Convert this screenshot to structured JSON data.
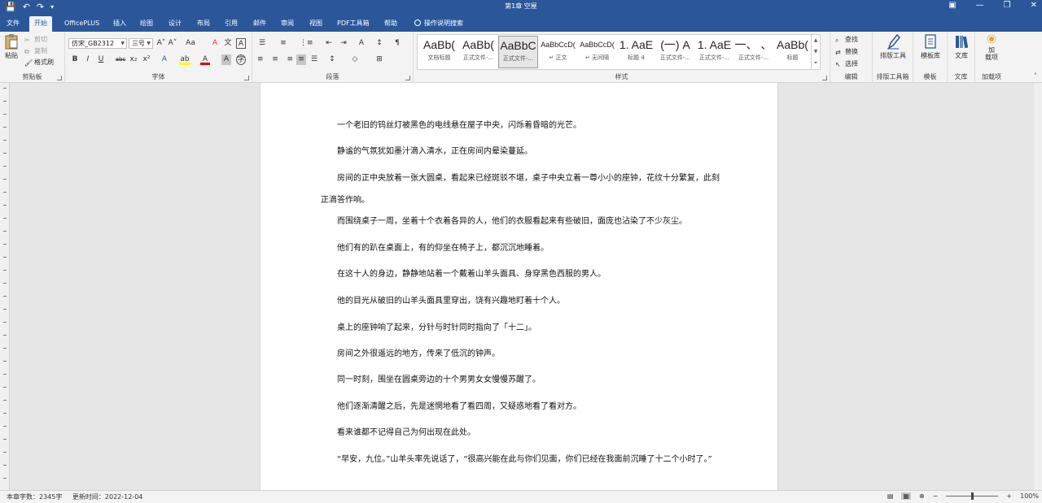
{
  "titlebar": {
    "title": "第1章 空屋",
    "quick_access": {
      "save": "💾",
      "undo": "↶",
      "redo": "↷",
      "customize": "▾"
    },
    "window_controls": {
      "ribbon_options": "▣",
      "minimize": "—",
      "restore": "❐",
      "close": "✕"
    }
  },
  "tabs": [
    "文件",
    "开始",
    "OfficePLUS",
    "插入",
    "绘图",
    "设计",
    "布局",
    "引用",
    "邮件",
    "审阅",
    "视图",
    "PDF工具箱",
    "帮助"
  ],
  "tell_me": "操作说明搜索",
  "clipboard": {
    "label": "剪贴板",
    "paste": "粘贴",
    "cut": "剪切",
    "copy": "复制",
    "format_painter": "格式刷"
  },
  "font": {
    "label": "字体",
    "name": "仿宋_GB2312",
    "size": "三号",
    "grow": "A˄",
    "shrink": "A˅",
    "case": "Aa",
    "clear": "A",
    "phonetic": "文",
    "border": "A",
    "bold": "B",
    "italic": "I",
    "underline": "U",
    "strike": "abc",
    "sub": "x₂",
    "sup": "x²",
    "effects": "A",
    "highlight": "ab",
    "color": "A",
    "shade": "A",
    "enclose": "字"
  },
  "paragraph": {
    "label": "段落",
    "bullets": "☰",
    "numbering": "≡",
    "multilevel": "⋮≡",
    "decrease_indent": "⇤",
    "increase_indent": "⇥",
    "chinese_layout": "A",
    "sort": "↕",
    "show_marks": "¶",
    "align_left": "≡",
    "align_center": "≡",
    "align_right": "≡",
    "justify": "≡",
    "distributed": "☰",
    "line_spacing": "↕",
    "shading": "◇",
    "borders": "⊞"
  },
  "styles": {
    "label": "样式",
    "items": [
      {
        "preview": "AaBb(",
        "name": "文档标题"
      },
      {
        "preview": "AaBb(",
        "name": "正式文件-..."
      },
      {
        "preview": "AaBbC",
        "name": "正式文件-..."
      },
      {
        "preview": "AaBbCcD(",
        "name": "↵ 正文"
      },
      {
        "preview": "AaBbCcD(",
        "name": "↵ 无间隔"
      },
      {
        "preview": "1. AaE",
        "name": "标题 4"
      },
      {
        "preview": "(一) A",
        "name": "正式文件-..."
      },
      {
        "preview": "1. AaE",
        "name": "正式文件-..."
      },
      {
        "preview": "一、 、",
        "name": "正式文件-..."
      },
      {
        "preview": "AaBb(",
        "name": "标题"
      }
    ],
    "scroll": {
      "up": "▲",
      "down": "▼",
      "more": "⏷"
    }
  },
  "editing": {
    "label": "编辑",
    "find": "查找",
    "replace": "替换",
    "select": "选择"
  },
  "layout_tools": {
    "label": "排版工具箱",
    "button": "排版工具"
  },
  "template": {
    "label": "模板",
    "button": "模板库"
  },
  "library": {
    "label": "文库",
    "button": "文库"
  },
  "addins": {
    "label": "加载项",
    "button": "加\n载项"
  },
  "document": {
    "paragraphs": [
      "一个老旧的钨丝灯被黑色的电线悬在屋子中央，闪烁着昏暗的光芒。",
      "静谧的气氛犹如墨汁滴入清水，正在房间内晕染蔓延。",
      "房间的正中央放着一张大圆桌，看起来已经斑驳不堪，桌子中央立着一尊小小的座钟，花纹十分繁复，此刻正滴答作响。",
      "而围绕桌子一周，坐着十个衣着各异的人，他们的衣服看起来有些破旧，面庞也沾染了不少灰尘。",
      "他们有的趴在桌面上，有的仰坐在椅子上，都沉沉地睡着。",
      "在这十人的身边，静静地站着一个戴着山羊头面具、身穿黑色西服的男人。",
      "他的目光从破旧的山羊头面具里穿出，饶有兴趣地盯着十个人。",
      "桌上的座钟响了起来，分针与时针同时指向了「十二」。",
      "房间之外很遥远的地方，传来了低沉的钟声。",
      "同一时刻，围坐在圆桌旁边的十个男男女女慢慢苏醒了。",
      "他们逐渐清醒之后，先是迷惘地看了看四周，又疑惑地看了看对方。",
      "看来谁都不记得自己为何出现在此处。",
      "“早安，九位。”山羊头率先说话了，“很高兴能在此与你们见面，你们已经在我面前沉睡了十二个小时了。”"
    ]
  },
  "statusbar": {
    "word_count": "本章字数：2345字",
    "updated": "更新时间：2022-12-04",
    "zoom": "100%",
    "zoom_minus": "−",
    "zoom_plus": "+",
    "zoom_level": 0.5
  },
  "colors": {
    "accent": "#2b579a",
    "highlight": "#ffff00",
    "font_color": "#e00000"
  }
}
